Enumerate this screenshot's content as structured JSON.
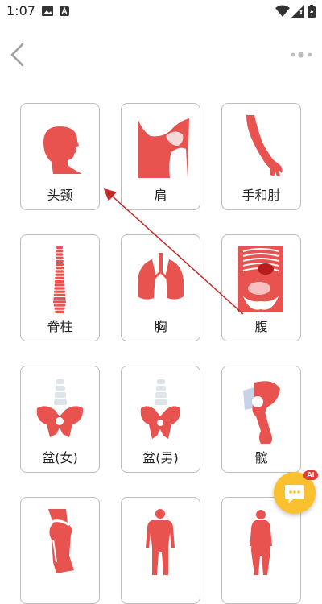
{
  "status_bar": {
    "time": "1:07",
    "notification_icons": [
      "image-icon",
      "a-app-icon"
    ],
    "system_icons": [
      "wifi-icon",
      "signal-icon",
      "battery-icon"
    ]
  },
  "header": {
    "back_icon": "chevron-left-icon",
    "more_icon": "more-dots-icon"
  },
  "grid": {
    "items": [
      {
        "label": "头颈",
        "icon": "head-neck-icon"
      },
      {
        "label": "肩",
        "icon": "shoulder-icon"
      },
      {
        "label": "手和肘",
        "icon": "hand-elbow-icon"
      },
      {
        "label": "脊柱",
        "icon": "spine-icon"
      },
      {
        "label": "胸",
        "icon": "lungs-icon"
      },
      {
        "label": "腹",
        "icon": "abdomen-icon"
      },
      {
        "label": "盆(女)",
        "icon": "pelvis-female-icon"
      },
      {
        "label": "盆(男)",
        "icon": "pelvis-male-icon"
      },
      {
        "label": "髋",
        "icon": "hip-icon"
      },
      {
        "label": "",
        "icon": "leg-icon"
      },
      {
        "label": "",
        "icon": "male-body-icon"
      },
      {
        "label": "",
        "icon": "female-body-icon"
      }
    ]
  },
  "fab": {
    "icon": "chat-icon",
    "badge": "AI"
  },
  "colors": {
    "figure_red": "#e8524f",
    "fab_yellow": "#fbc02d",
    "badge_red": "#e53935",
    "arrow_red": "#c62828"
  }
}
